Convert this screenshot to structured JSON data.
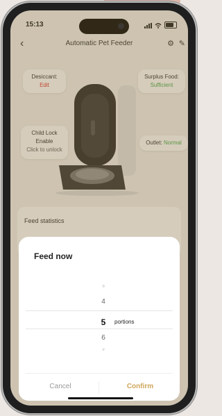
{
  "status_bar": {
    "time": "15:13"
  },
  "header": {
    "title": "Automatic Pet Feeder"
  },
  "device": {
    "desiccant": {
      "label": "Desiccant:",
      "value": "Edit"
    },
    "surplus_food": {
      "label": "Surplus Food:",
      "value": "Sufficient"
    },
    "child_lock": {
      "line1": "Child Lock",
      "line2": "Enable",
      "action": "Click to unlock"
    },
    "outlet": {
      "label": "Outlet:",
      "value": "Normal"
    }
  },
  "feed_statistics": {
    "title": "Feed statistics"
  },
  "dialog": {
    "title": "Feed now",
    "options": [
      "3",
      "4",
      "5",
      "6",
      "7"
    ],
    "selected": "5",
    "unit": "portions",
    "cancel_label": "Cancel",
    "confirm_label": "Confirm"
  },
  "colors": {
    "accent": "#cfa75c",
    "ok": "#4caf50",
    "warn": "#e53935"
  }
}
